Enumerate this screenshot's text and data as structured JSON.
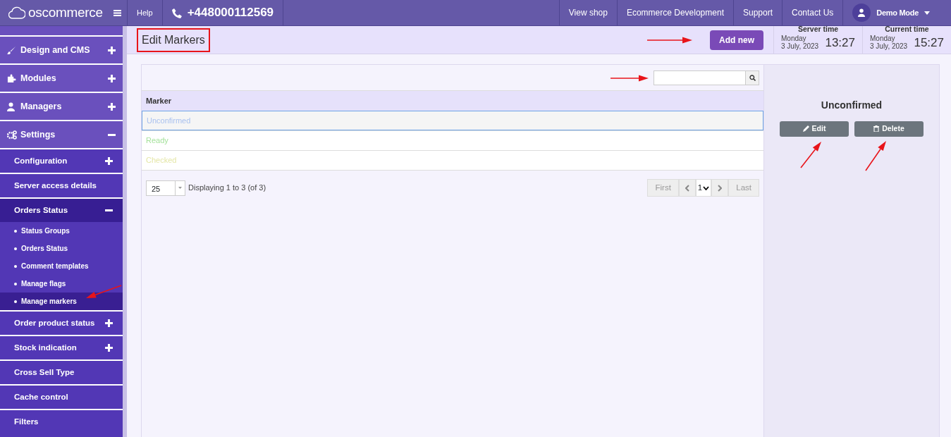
{
  "topbar": {
    "logo": "oscommerce",
    "help": "Help",
    "phone": "+448000112569",
    "links": [
      "View shop",
      "Ecommerce Development",
      "Support",
      "Contact Us"
    ],
    "user": "Demo Mode"
  },
  "sidebar": {
    "items": [
      {
        "label": "Design and CMS",
        "expanded": false
      },
      {
        "label": "Modules",
        "expanded": false
      },
      {
        "label": "Managers",
        "expanded": false
      },
      {
        "label": "Settings",
        "expanded": true,
        "children": [
          {
            "label": "Configuration",
            "expanded": false
          },
          {
            "label": "Server access details"
          },
          {
            "label": "Orders Status",
            "expanded": true,
            "children": [
              {
                "label": "Status Groups",
                "selected": false
              },
              {
                "label": "Orders Status",
                "selected": false
              },
              {
                "label": "Comment templates",
                "selected": false
              },
              {
                "label": "Manage flags",
                "selected": false
              },
              {
                "label": "Manage markers",
                "selected": true
              }
            ]
          },
          {
            "label": "Order product status",
            "expanded": false
          },
          {
            "label": "Stock indication",
            "expanded": false
          },
          {
            "label": "Cross Sell Type"
          },
          {
            "label": "Cache control"
          },
          {
            "label": "Filters"
          }
        ]
      }
    ]
  },
  "header": {
    "title": "Edit Markers",
    "add_button": "Add new",
    "server_time": {
      "label": "Server time",
      "day": "Monday",
      "date": "3 July, 2023",
      "time": "13:27"
    },
    "current_time": {
      "label": "Current time",
      "day": "Monday",
      "date": "3 July, 2023",
      "time": "15:27"
    }
  },
  "table": {
    "columns": [
      "Marker"
    ],
    "rows": [
      {
        "name": "Unconfirmed",
        "color": "#a9c1ef",
        "selected": true
      },
      {
        "name": "Ready",
        "color": "#a6e29c",
        "selected": false
      },
      {
        "name": "Checked",
        "color": "#e4e6a6",
        "selected": false
      }
    ],
    "per_page": "25",
    "summary": "Displaying 1 to 3 (of 3)",
    "pagination": {
      "first": "First",
      "page": "1",
      "last": "Last"
    }
  },
  "detail": {
    "title": "Unconfirmed",
    "buttons": [
      "Edit",
      "Delete"
    ]
  }
}
